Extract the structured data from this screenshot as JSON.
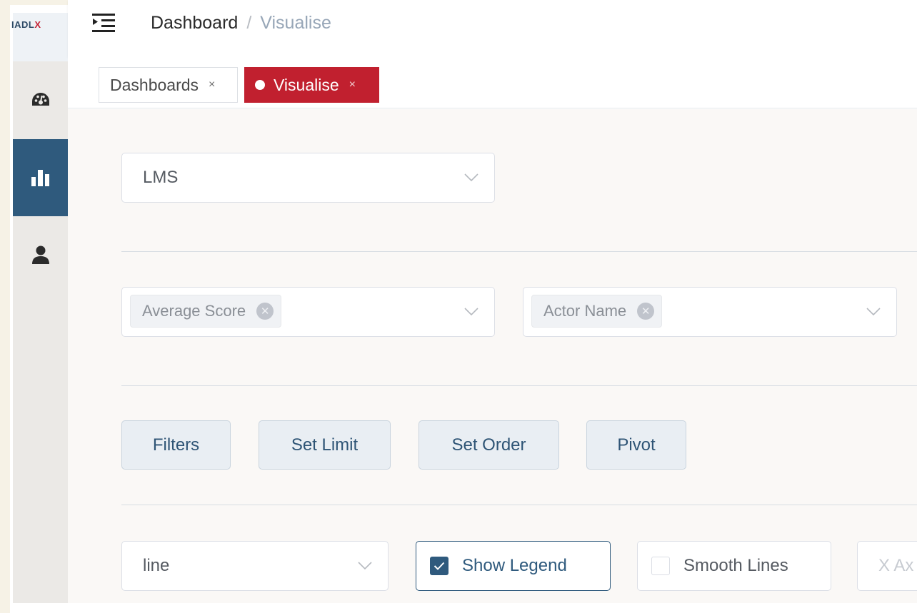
{
  "app": {
    "logo_text_dark": "IADL",
    "logo_text_red": "X"
  },
  "breadcrumb": {
    "home": "Dashboard",
    "separator": "/",
    "current": "Visualise"
  },
  "sidebar": {
    "items": [
      {
        "name": "dashboard",
        "icon": "dashboard-gauge-icon",
        "active": false
      },
      {
        "name": "visualise",
        "icon": "bar-chart-icon",
        "active": true
      },
      {
        "name": "users",
        "icon": "user-icon",
        "active": false
      }
    ]
  },
  "tabs": [
    {
      "label": "Dashboards",
      "close": "×"
    },
    {
      "label": "Visualise",
      "close": "×",
      "active": true
    }
  ],
  "source_select": {
    "value": "LMS"
  },
  "measures_select": {
    "tags": [
      {
        "label": "Average Score"
      }
    ]
  },
  "dimensions_select": {
    "tags": [
      {
        "label": "Actor Name"
      }
    ]
  },
  "actions": {
    "filters": "Filters",
    "set_limit": "Set Limit",
    "set_order": "Set Order",
    "pivot": "Pivot"
  },
  "chart_options": {
    "type_value": "line",
    "show_legend": {
      "label": "Show Legend",
      "checked": true
    },
    "smooth_lines": {
      "label": "Smooth Lines",
      "checked": false
    },
    "x_axis_placeholder": "X Ax"
  },
  "colors": {
    "accent": "#2f5a7d",
    "active_tab": "#c1202f"
  }
}
